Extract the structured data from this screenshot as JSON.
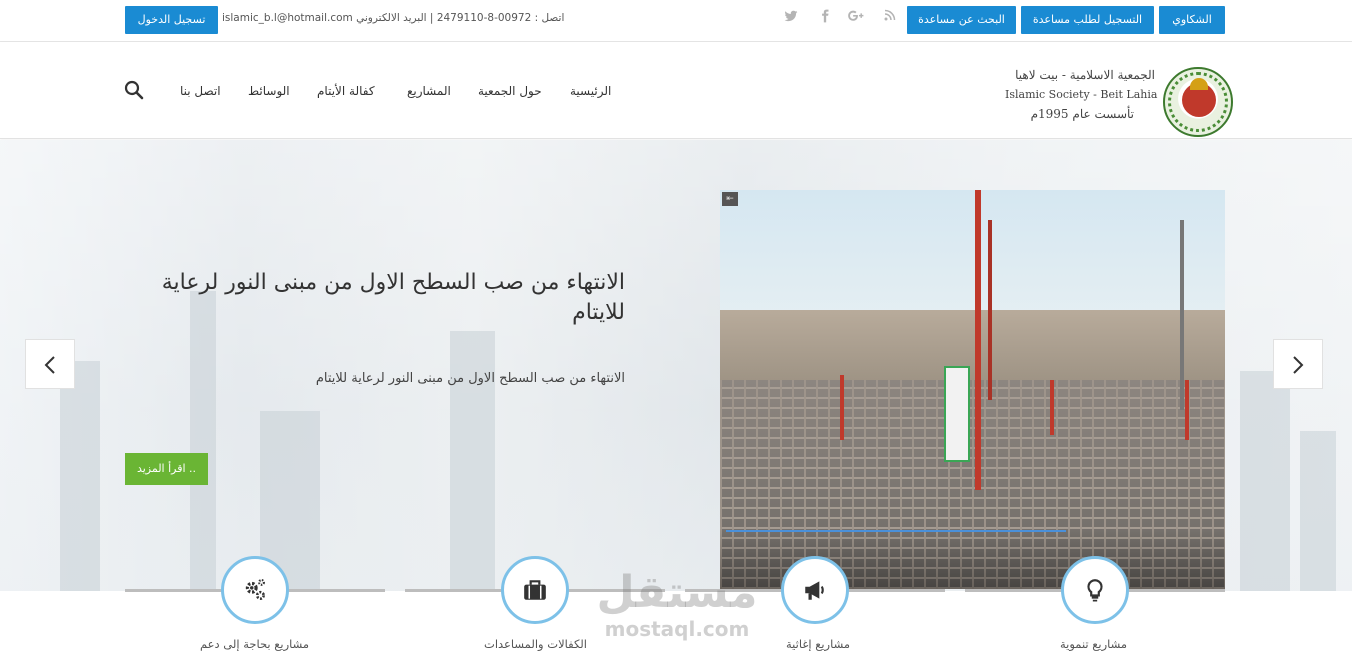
{
  "topbar": {
    "login_label": "تسجيل الدخول",
    "contact_text": "اتصل : 00972-8-2479110 | البريد الالكتروني islamic_b.l@hotmail.com",
    "buttons": [
      "الشكاوي",
      "التسجيل لطلب مساعدة",
      "البحث عن مساعدة"
    ],
    "social_icons": [
      "rss-icon",
      "google-plus-icon",
      "facebook-icon",
      "twitter-icon"
    ],
    "accent": "#1a8bd3"
  },
  "header": {
    "org_name_ar": "الجمعية الاسلامية - بيت لاهيا",
    "org_name_en": "Islamic Society - Beit Lahia",
    "founded": "تأسست عام 1995م",
    "nav": [
      "الرئيسية",
      "حول الجمعية",
      "المشاريع",
      "كفالة الأيتام",
      "الوسائط",
      "اتصل بنا"
    ]
  },
  "hero": {
    "title": "الانتهاء من صب السطح الاول من مبنى النور لرعاية للايتام",
    "subtitle": "الانتهاء من صب السطح الاول من مبنى النور لرعاية للايتام",
    "read_more": "اقرأ المزيد ..",
    "read_more_color": "#6ab534"
  },
  "features": [
    {
      "label": "مشاريع تنموية",
      "icon": "lightbulb-icon"
    },
    {
      "label": "مشاريع إغاثية",
      "icon": "megaphone-icon"
    },
    {
      "label": "الكفالات والمساعدات",
      "icon": "briefcase-icon"
    },
    {
      "label": "مشاريع بحاجة إلى دعم",
      "icon": "gears-icon"
    }
  ],
  "watermark": {
    "ar": "مستقل",
    "en": "mostaql.com"
  }
}
